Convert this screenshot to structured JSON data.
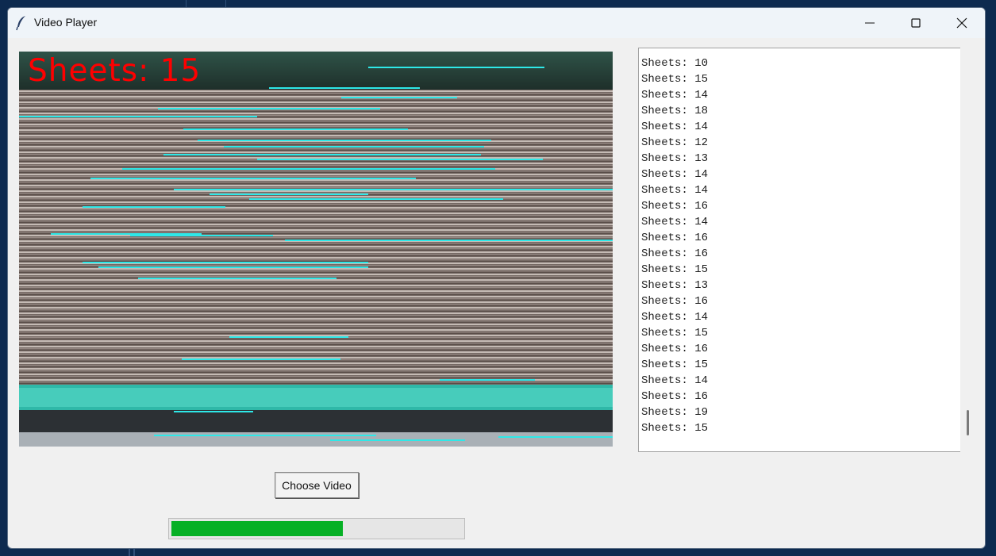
{
  "window": {
    "title": "Video Player",
    "controls": [
      "minimize",
      "maximize",
      "close"
    ]
  },
  "video": {
    "overlay_text": "Sheets: 15"
  },
  "log": {
    "lines": [
      "Sheets: 10",
      "Sheets: 15",
      "Sheets: 14",
      "Sheets: 18",
      "Sheets: 14",
      "Sheets: 12",
      "Sheets: 13",
      "Sheets: 14",
      "Sheets: 14",
      "Sheets: 16",
      "Sheets: 14",
      "Sheets: 16",
      "Sheets: 16",
      "Sheets: 15",
      "Sheets: 13",
      "Sheets: 16",
      "Sheets: 14",
      "Sheets: 15",
      "Sheets: 16",
      "Sheets: 15",
      "Sheets: 14",
      "Sheets: 16",
      "Sheets: 19",
      "Sheets: 15"
    ]
  },
  "controls": {
    "choose_video_label": "Choose Video",
    "progress_fraction": 0.59
  },
  "colors": {
    "overlay_text": "#ff0000",
    "detected_lines": "#2ee8e8",
    "progress_fill": "#06b025"
  }
}
